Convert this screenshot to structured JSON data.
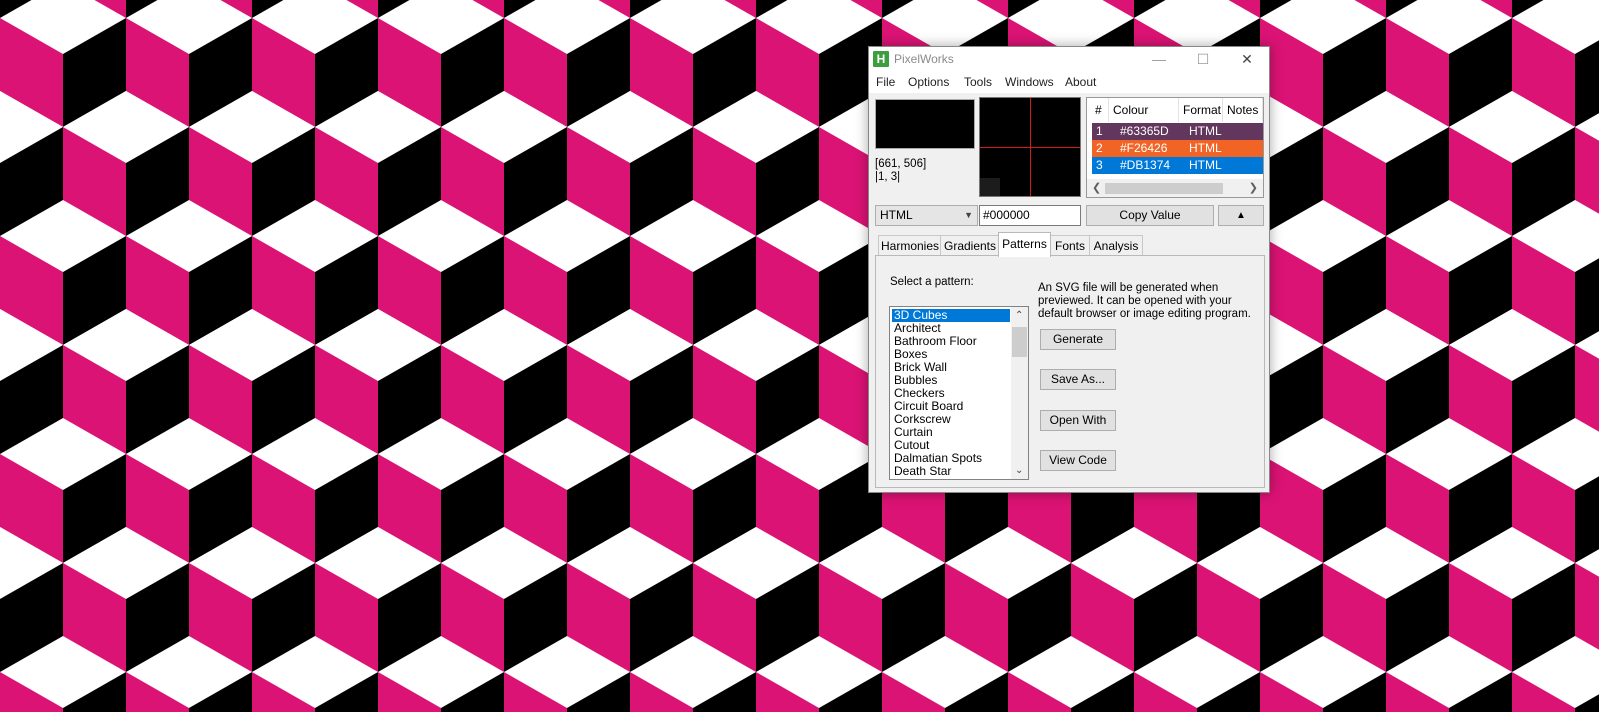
{
  "background_pattern": {
    "colors": {
      "top": "#ffffff",
      "left": "#db1374",
      "right": "#000000"
    }
  },
  "window": {
    "title": "PixelWorks",
    "app_icon_letter": "H",
    "controls": {
      "minimize": "—",
      "maximize": "☐",
      "close": "✕"
    }
  },
  "menu": [
    "File",
    "Options",
    "Tools",
    "Windows",
    "About"
  ],
  "picker": {
    "swatch_color": "#000000",
    "coordinates": "[661, 506]",
    "pixel_index": "|1, 3|"
  },
  "colour_table": {
    "headers": [
      "#",
      "Colour",
      "Format",
      "Notes"
    ],
    "rows": [
      {
        "index": "1",
        "colour": "#63365D",
        "format": "HTML",
        "bg": "#63365d"
      },
      {
        "index": "2",
        "colour": "#F26426",
        "format": "HTML",
        "bg": "#f26426"
      },
      {
        "index": "3",
        "colour": "#DB1374",
        "format": "HTML",
        "bg": "#0078d7"
      }
    ]
  },
  "format_select": {
    "value": "HTML"
  },
  "hex_input": {
    "value": "#000000"
  },
  "buttons": {
    "copy_value": "Copy Value",
    "up": "▲"
  },
  "tabs": [
    "Harmonies",
    "Gradients",
    "Patterns",
    "Fonts",
    "Analysis"
  ],
  "active_tab": "Patterns",
  "patterns_panel": {
    "select_label": "Select a pattern:",
    "items": [
      "3D Cubes",
      "Architect",
      "Bathroom Floor",
      "Boxes",
      "Brick Wall",
      "Bubbles",
      "Checkers",
      "Circuit Board",
      "Corkscrew",
      "Curtain",
      "Cutout",
      "Dalmatian Spots",
      "Death Star"
    ],
    "selected": "3D Cubes",
    "description": "An SVG file will be generated when previewed. It can be opened with your default browser or image editing program.",
    "actions": [
      "Generate",
      "Save As...",
      "Open With",
      "View Code"
    ]
  }
}
